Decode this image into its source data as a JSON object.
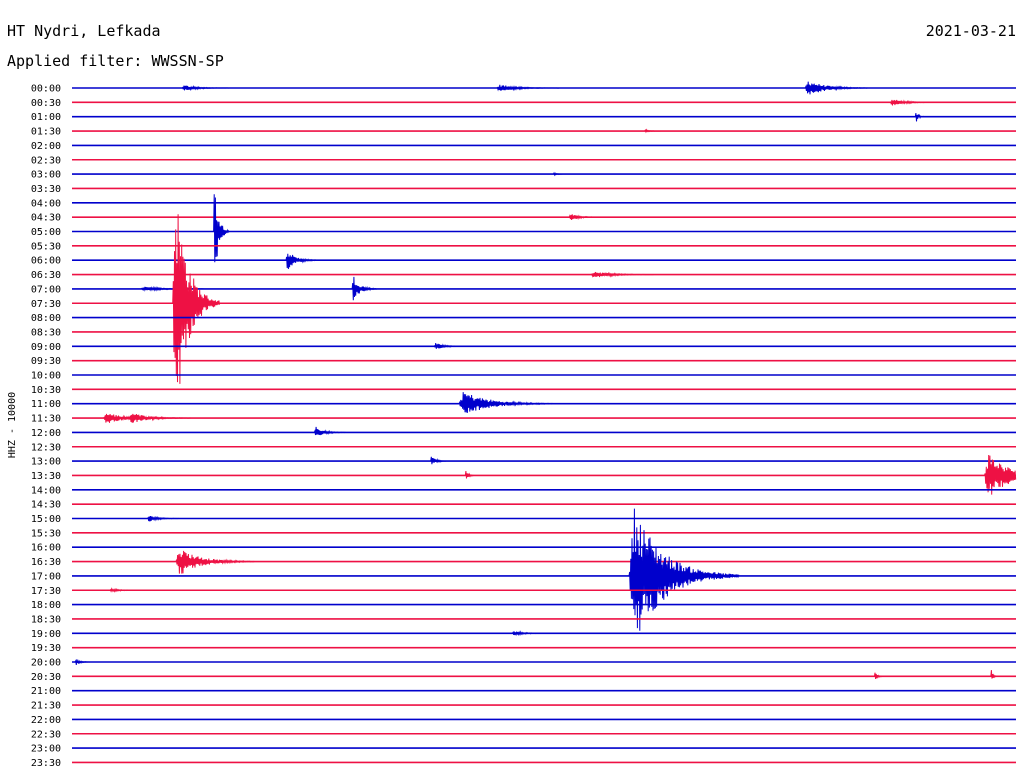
{
  "header": {
    "station": "HT Nydri, Lefkada",
    "date": "2021-03-21",
    "filter_text": "Applied filter: WWSSN-SP"
  },
  "chart_data": {
    "type": "line",
    "title": "HT Nydri, Lefkada",
    "date": "2021-03-21",
    "subtitle": "Applied filter: WWSSN-SP",
    "ylabel": "HHZ - 10000",
    "rows": [
      "00:00",
      "00:30",
      "01:00",
      "01:30",
      "02:00",
      "02:30",
      "03:00",
      "03:30",
      "04:00",
      "04:30",
      "05:00",
      "05:30",
      "06:00",
      "06:30",
      "07:00",
      "07:30",
      "08:00",
      "08:30",
      "09:00",
      "09:30",
      "10:00",
      "10:30",
      "11:00",
      "11:30",
      "12:00",
      "12:30",
      "13:00",
      "13:30",
      "14:00",
      "14:30",
      "15:00",
      "15:30",
      "16:00",
      "16:30",
      "17:00",
      "17:30",
      "18:00",
      "18:30",
      "19:00",
      "19:30",
      "20:00",
      "20:30",
      "21:00",
      "21:30",
      "22:00",
      "22:30",
      "23:00",
      "23:30"
    ],
    "colors": [
      "#0000cc",
      "#ee1144"
    ],
    "row_minutes": 30,
    "events": [
      {
        "row": "00:00",
        "minute": 3.5,
        "amplitude": 0.25,
        "duration": 1.5
      },
      {
        "row": "00:00",
        "minute": 13.5,
        "amplitude": 0.3,
        "duration": 2
      },
      {
        "row": "00:00",
        "minute": 23.3,
        "amplitude": 0.7,
        "duration": 2
      },
      {
        "row": "00:30",
        "minute": 26,
        "amplitude": 0.3,
        "duration": 1.5
      },
      {
        "row": "01:00",
        "minute": 26.8,
        "amplitude": 0.6,
        "duration": 0.3
      },
      {
        "row": "01:30",
        "minute": 18.2,
        "amplitude": 0.15,
        "duration": 0.5
      },
      {
        "row": "03:00",
        "minute": 15.3,
        "amplitude": 0.15,
        "duration": 0.3
      },
      {
        "row": "04:30",
        "minute": 15.8,
        "amplitude": 0.3,
        "duration": 1
      },
      {
        "row": "05:00",
        "minute": 4.5,
        "amplitude": 4.5,
        "duration": 0.5
      },
      {
        "row": "06:00",
        "minute": 6.8,
        "amplitude": 0.9,
        "duration": 1
      },
      {
        "row": "06:30",
        "minute": 16.5,
        "amplitude": 0.3,
        "duration": 2
      },
      {
        "row": "07:00",
        "minute": 2.2,
        "amplitude": 0.2,
        "duration": 2
      },
      {
        "row": "07:00",
        "minute": 8.9,
        "amplitude": 1.2,
        "duration": 0.8
      },
      {
        "row": "07:30",
        "minute": 3.2,
        "amplitude": 10.5,
        "duration": 1.5
      },
      {
        "row": "09:00",
        "minute": 11.5,
        "amplitude": 0.3,
        "duration": 1
      },
      {
        "row": "11:00",
        "minute": 12.3,
        "amplitude": 1.1,
        "duration": 3
      },
      {
        "row": "11:30",
        "minute": 1,
        "amplitude": 0.5,
        "duration": 2
      },
      {
        "row": "11:30",
        "minute": 1.8,
        "amplitude": 0.5,
        "duration": 2
      },
      {
        "row": "12:00",
        "minute": 7.7,
        "amplitude": 0.5,
        "duration": 1
      },
      {
        "row": "13:00",
        "minute": 11.4,
        "amplitude": 0.5,
        "duration": 0.5
      },
      {
        "row": "13:30",
        "minute": 12.5,
        "amplitude": 0.5,
        "duration": 0.3
      },
      {
        "row": "13:30",
        "minute": 29,
        "amplitude": 2,
        "duration": 2.5
      },
      {
        "row": "15:00",
        "minute": 2.4,
        "amplitude": 0.3,
        "duration": 1
      },
      {
        "row": "16:30",
        "minute": 3.3,
        "amplitude": 1.2,
        "duration": 2.5
      },
      {
        "row": "17:00",
        "minute": 17.7,
        "amplitude": 6,
        "duration": 3.5
      },
      {
        "row": "17:30",
        "minute": 1.2,
        "amplitude": 0.15,
        "duration": 1
      },
      {
        "row": "19:00",
        "minute": 14,
        "amplitude": 0.25,
        "duration": 1
      },
      {
        "row": "19:30",
        "minute": 30,
        "amplitude": 0.6,
        "duration": 2
      },
      {
        "row": "20:00",
        "minute": 0.1,
        "amplitude": 0.3,
        "duration": 0.5
      },
      {
        "row": "20:30",
        "minute": 25.5,
        "amplitude": 0.4,
        "duration": 0.3
      },
      {
        "row": "20:30",
        "minute": 29.2,
        "amplitude": 0.7,
        "duration": 0.2
      }
    ]
  }
}
